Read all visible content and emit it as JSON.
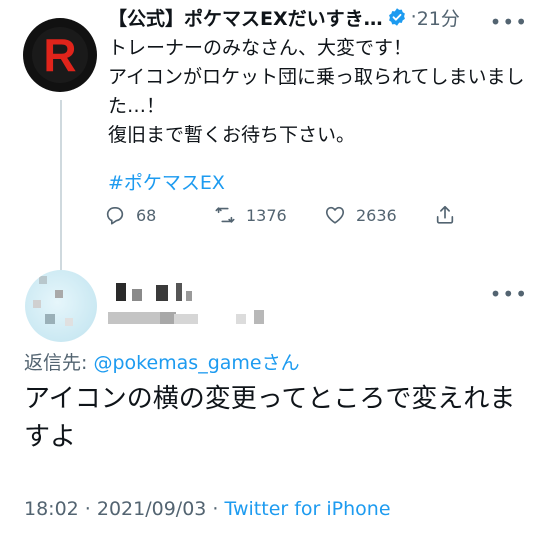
{
  "tweet": {
    "author_name": "【公式】ポケマスEXだいすき…",
    "time_sep": "·",
    "time": "21分",
    "body": "トレーナーのみなさん、大変です！\nアイコンがロケット団に乗っ取られてしまいました…！\n復旧まで暫くお待ち下さい。",
    "hashtag": "#ポケマスEX",
    "avatar_letter": "R",
    "actions": {
      "replies": "68",
      "retweets": "1376",
      "likes": "2636"
    }
  },
  "reply": {
    "reply_to_prefix": "返信先: ",
    "reply_to_handle": "@pokemas_game",
    "reply_to_suffix": "さん",
    "body": "アイコンの横の変更ってところで変えれますよ",
    "timestamp": "18:02 · 2021/09/03",
    "footer_sep": " · ",
    "source": "Twitter for iPhone"
  },
  "colors": {
    "link": "#1d9bf0",
    "secondary_text": "#536471",
    "avatar_r": "#e0241b"
  },
  "icons": {
    "more": "more-icon",
    "verified": "verified-badge-icon",
    "reply": "reply-icon",
    "retweet": "retweet-icon",
    "like": "like-icon",
    "share": "share-icon"
  }
}
